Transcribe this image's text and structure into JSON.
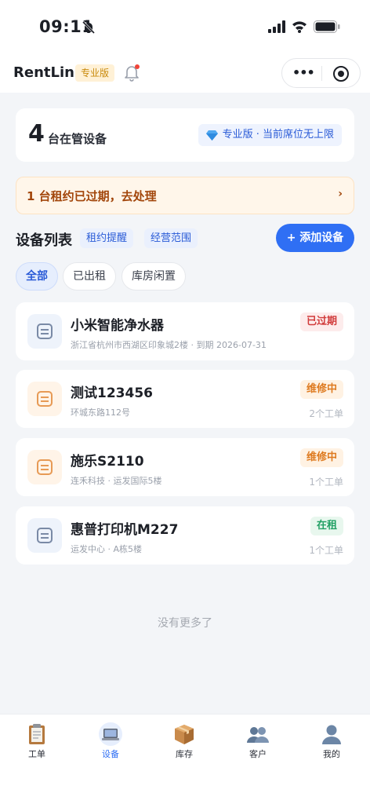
{
  "status_bar": {
    "time": "09:11"
  },
  "nav": {
    "brand": "RentLink",
    "tag": "专业版"
  },
  "summary": {
    "count": "4",
    "label": "台在管设备",
    "plan": "专业版 · 当前席位无上限"
  },
  "alert": {
    "text": "1 台租约已过期，去处理",
    "chevron": "›"
  },
  "list": {
    "title": "设备列表",
    "chips": [
      "租约提醒",
      "经营范围"
    ],
    "add_button": "+ 添加设备",
    "filters": [
      "全部",
      "已出租",
      "库房闲置"
    ]
  },
  "devices": [
    {
      "name": "小米智能净水器",
      "sub": "浙江省杭州市西湖区印象城2楼 · 到期 2026-07-31",
      "status": "已过期",
      "orders": "",
      "icon": "device-icon",
      "icon_color": "blue",
      "status_color": "red"
    },
    {
      "name": "测试123456",
      "sub": "环城东路112号",
      "status": "维修中",
      "orders": "2个工单",
      "icon": "device-icon",
      "icon_color": "orange",
      "status_color": "orange"
    },
    {
      "name": "施乐S2110",
      "sub": "连禾科技 · 运发国际5楼",
      "status": "维修中",
      "orders": "1个工单",
      "icon": "device-icon",
      "icon_color": "orange",
      "status_color": "orange"
    },
    {
      "name": "惠普打印机M227",
      "sub": "运发中心 · A栋5楼",
      "status": "在租",
      "orders": "1个工单",
      "icon": "device-icon",
      "icon_color": "blue",
      "status_color": "green"
    }
  ],
  "end_text": "没有更多了",
  "tabs": [
    {
      "label": "工单",
      "icon": "clipboard-icon"
    },
    {
      "label": "设备",
      "icon": "laptop-icon",
      "active": true
    },
    {
      "label": "库存",
      "icon": "package-icon"
    },
    {
      "label": "客户",
      "icon": "users-icon"
    },
    {
      "label": "我的",
      "icon": "user-icon"
    }
  ],
  "colors": {
    "accent": "#2f6ff4",
    "alert_bg": "#fff6ea",
    "alert_text": "#a2460b"
  }
}
